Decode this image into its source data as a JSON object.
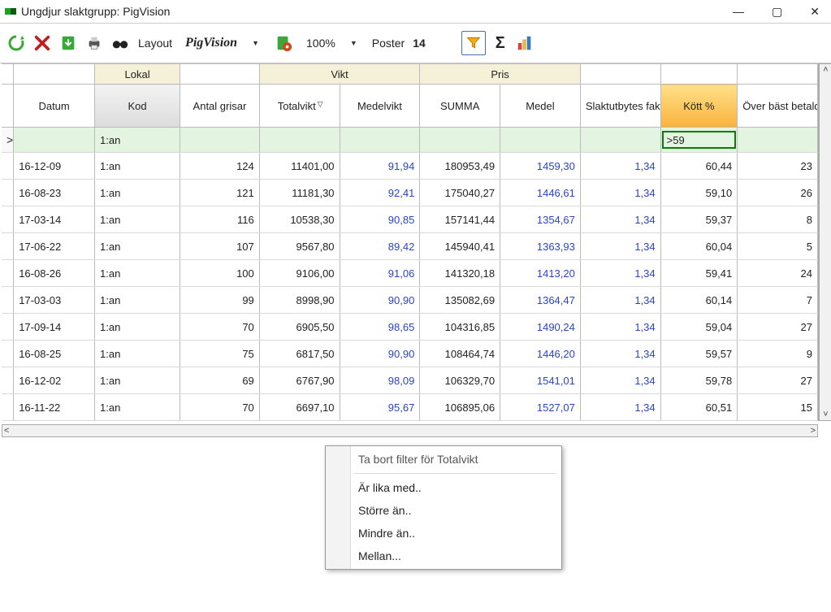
{
  "window": {
    "title": "Ungdjur slaktgrupp: PigVision"
  },
  "toolbar": {
    "layout_label": "Layout",
    "layout_value": "PigVision",
    "zoom": "100%",
    "poster_label": "Poster",
    "poster_count": "14"
  },
  "columns": {
    "grp_lokal": "Lokal",
    "grp_vikt": "Vikt",
    "grp_pris": "Pris",
    "datum": "Datum",
    "kod": "Kod",
    "antal": "Antal grisar",
    "totv": "Totalvikt",
    "medv": "Medelvikt",
    "summa": "SUMMA",
    "medel": "Medel",
    "faktor": "Slaktutbytes faktor",
    "kott": "Kött %",
    "over": "Över bäst betalda"
  },
  "filter": {
    "rowmark": ">",
    "kod": "1:an",
    "kott": ">59"
  },
  "rows": [
    {
      "datum": "16-12-09",
      "kod": "1:an",
      "antal": "124",
      "totv": "11401,00",
      "medv": "91,94",
      "summa": "180953,49",
      "medel": "1459,30",
      "faktor": "1,34",
      "kott": "60,44",
      "over": "23"
    },
    {
      "datum": "16-08-23",
      "kod": "1:an",
      "antal": "121",
      "totv": "11181,30",
      "medv": "92,41",
      "summa": "175040,27",
      "medel": "1446,61",
      "faktor": "1,34",
      "kott": "59,10",
      "over": "26"
    },
    {
      "datum": "17-03-14",
      "kod": "1:an",
      "antal": "116",
      "totv": "10538,30",
      "medv": "90,85",
      "summa": "157141,44",
      "medel": "1354,67",
      "faktor": "1,34",
      "kott": "59,37",
      "over": "8"
    },
    {
      "datum": "17-06-22",
      "kod": "1:an",
      "antal": "107",
      "totv": "9567,80",
      "medv": "89,42",
      "summa": "145940,41",
      "medel": "1363,93",
      "faktor": "1,34",
      "kott": "60,04",
      "over": "5"
    },
    {
      "datum": "16-08-26",
      "kod": "1:an",
      "antal": "100",
      "totv": "9106,00",
      "medv": "91,06",
      "summa": "141320,18",
      "medel": "1413,20",
      "faktor": "1,34",
      "kott": "59,41",
      "over": "24"
    },
    {
      "datum": "17-03-03",
      "kod": "1:an",
      "antal": "99",
      "totv": "8998,90",
      "medv": "90,90",
      "summa": "135082,69",
      "medel": "1364,47",
      "faktor": "1,34",
      "kott": "60,14",
      "over": "7"
    },
    {
      "datum": "17-09-14",
      "kod": "1:an",
      "antal": "70",
      "totv": "6905,50",
      "medv": "98,65",
      "summa": "104316,85",
      "medel": "1490,24",
      "faktor": "1,34",
      "kott": "59,04",
      "over": "27"
    },
    {
      "datum": "16-08-25",
      "kod": "1:an",
      "antal": "75",
      "totv": "6817,50",
      "medv": "90,90",
      "summa": "108464,74",
      "medel": "1446,20",
      "faktor": "1,34",
      "kott": "59,57",
      "over": "9"
    },
    {
      "datum": "16-12-02",
      "kod": "1:an",
      "antal": "69",
      "totv": "6767,90",
      "medv": "98,09",
      "summa": "106329,70",
      "medel": "1541,01",
      "faktor": "1,34",
      "kott": "59,78",
      "over": "27"
    },
    {
      "datum": "16-11-22",
      "kod": "1:an",
      "antal": "70",
      "totv": "6697,10",
      "medv": "95,67",
      "summa": "106895,06",
      "medel": "1527,07",
      "faktor": "1,34",
      "kott": "60,51",
      "over": "15"
    }
  ],
  "context_menu": {
    "remove": "Ta bort filter för Totalvikt",
    "equals": "Är lika med..",
    "greater": "Större än..",
    "less": "Mindre än..",
    "between": "Mellan..."
  }
}
